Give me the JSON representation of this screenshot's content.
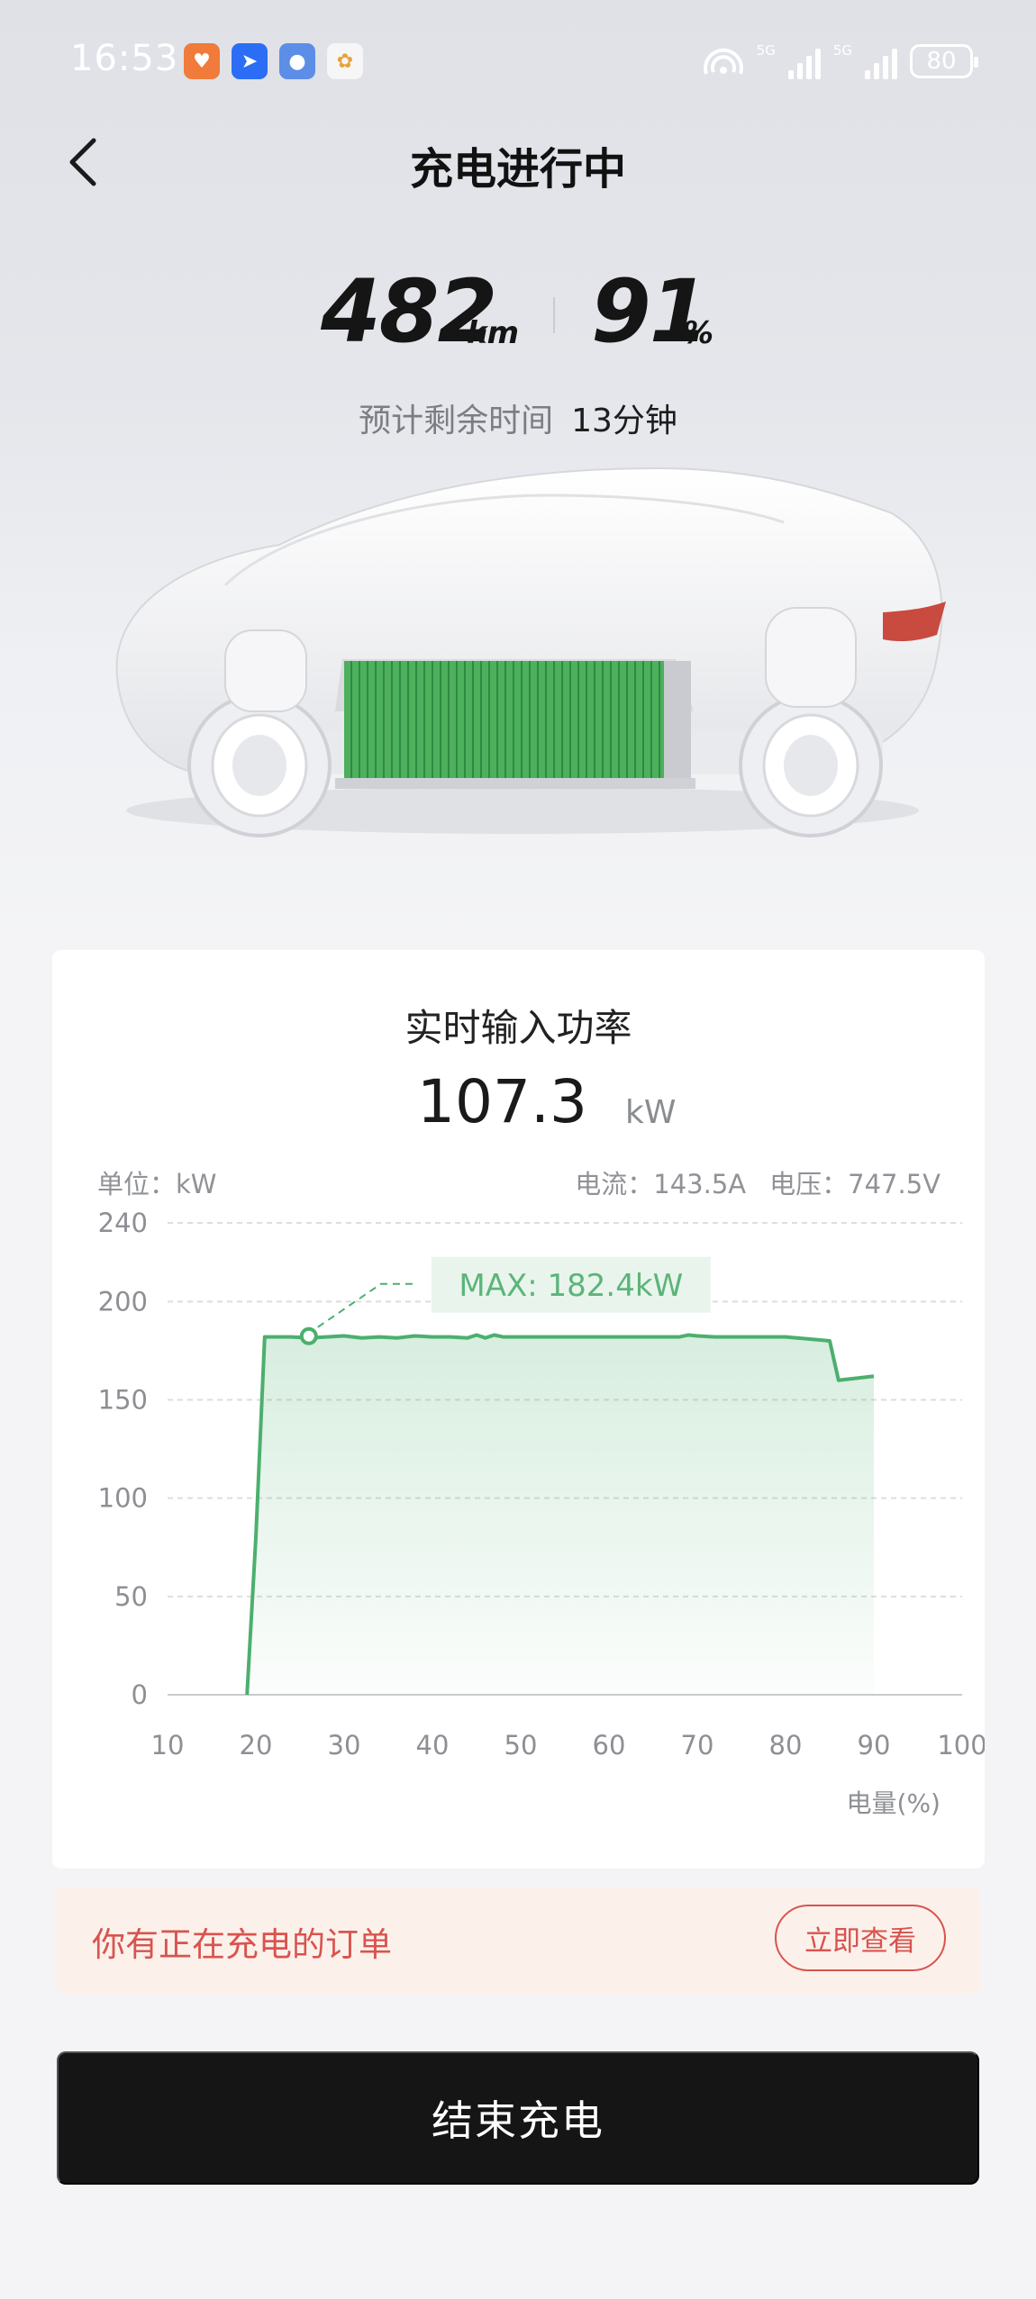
{
  "status_bar": {
    "time": "16:53",
    "battery": "80",
    "network_1": "5G",
    "network_2": "5G",
    "icons": [
      "heart-app-icon",
      "arrow-app-icon",
      "planet-app-icon",
      "pinwheel-app-icon",
      "hotspot-icon",
      "signal-icon",
      "battery-icon"
    ]
  },
  "header": {
    "title": "充电进行中",
    "back_icon": "chevron-left-icon"
  },
  "stats": {
    "range_value": "482",
    "range_unit": "km",
    "soc_value": "91",
    "soc_unit": "%",
    "eta_label": "预计剩余时间",
    "eta_value": "13分钟"
  },
  "chart_card": {
    "title": "实时输入功率",
    "power_value": "107.3",
    "power_unit": "kW",
    "unit_label": "单位：kW",
    "current_label": "电流：143.5A",
    "voltage_label": "电压：747.5V",
    "max_label": "MAX: 182.4kW"
  },
  "chart_data": {
    "type": "area",
    "xlabel": "电量(%)",
    "ylabel": "",
    "xlim": [
      10,
      100
    ],
    "ylim": [
      0,
      240
    ],
    "x_ticks": [
      10,
      20,
      30,
      40,
      50,
      60,
      70,
      80,
      90,
      100
    ],
    "y_ticks": [
      0,
      50,
      100,
      150,
      200,
      240
    ],
    "grid": true,
    "line_color": "#4caf6e",
    "annotation": {
      "text": "MAX: 182.4kW",
      "x": 26,
      "y": 182.4
    },
    "series": [
      {
        "x": [
          19,
          20,
          21,
          24,
          26,
          28,
          30,
          32,
          34,
          36,
          38,
          40,
          42,
          44,
          45,
          46,
          47,
          48,
          50,
          55,
          60,
          65,
          68,
          69,
          70,
          72,
          75,
          80,
          85,
          85.5,
          86,
          88,
          90
        ],
        "y": [
          0,
          80,
          182,
          182,
          181.5,
          182,
          182.5,
          181.5,
          182,
          181.5,
          182.5,
          182,
          182,
          181.5,
          183,
          181.5,
          183,
          182,
          182,
          182,
          182,
          182,
          182,
          183,
          182.5,
          182,
          182,
          182,
          180,
          170,
          160,
          161,
          162
        ]
      }
    ]
  },
  "order_banner": {
    "text": "你有正在充电的订单",
    "button": "立即查看"
  },
  "end_button": {
    "label": "结束充电"
  },
  "colors": {
    "accent_green": "#4caf6e",
    "warn_red": "#d9534f",
    "banner_bg": "#fbf1ea",
    "button_dark": "#151515"
  }
}
